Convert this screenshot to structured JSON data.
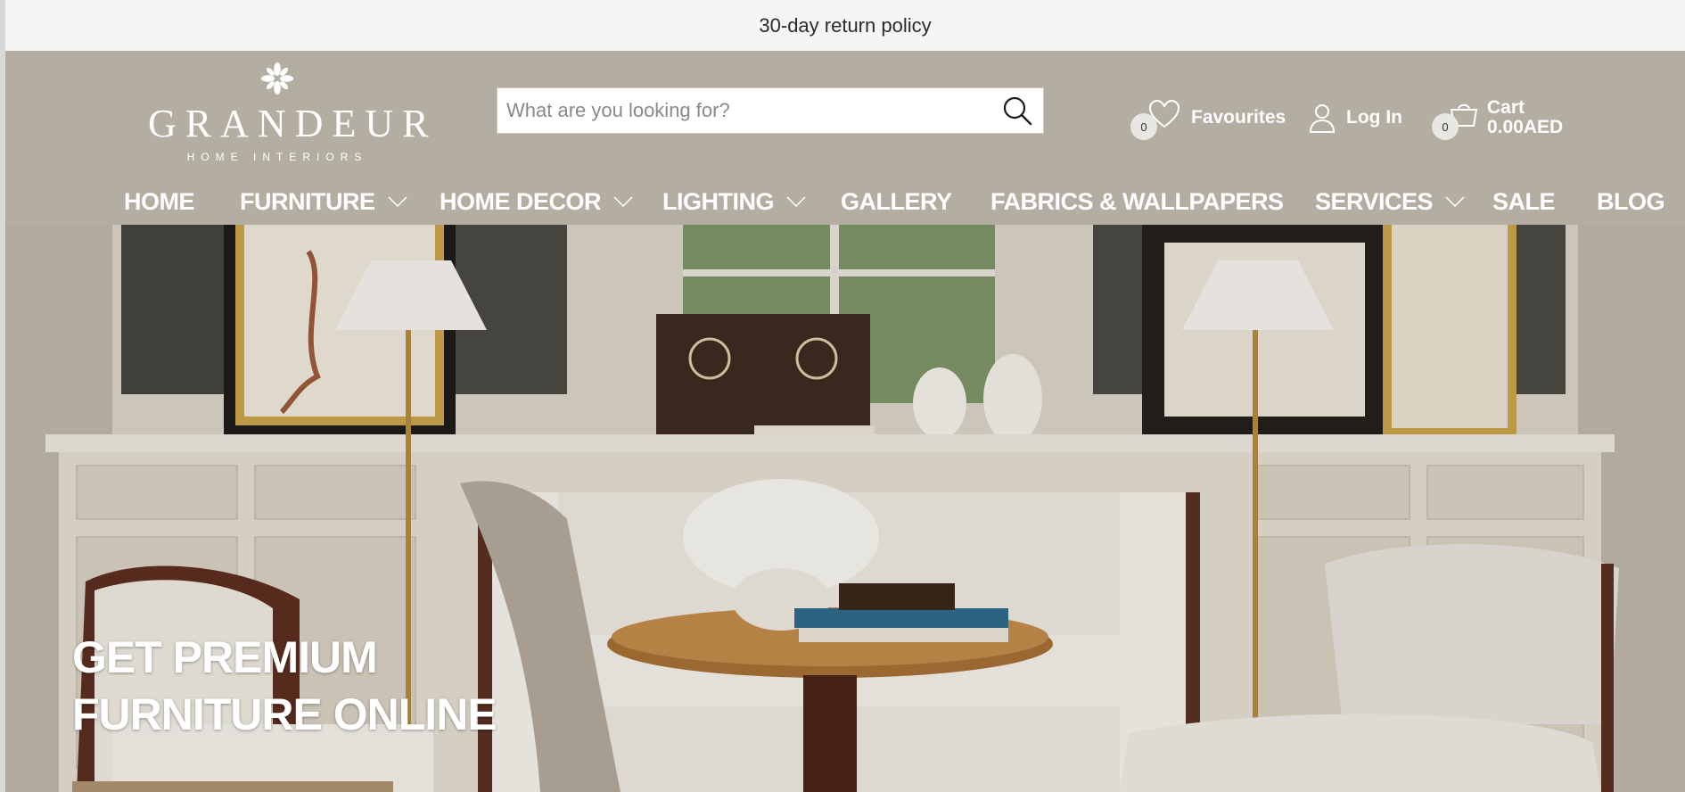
{
  "announcement": {
    "text": "30-day return policy"
  },
  "brand": {
    "name": "GRANDEUR",
    "tagline": "HOME INTERIORS"
  },
  "search": {
    "placeholder": "What are you looking for?",
    "icon": "search-icon"
  },
  "header_actions": {
    "favourites": {
      "label": "Favourites",
      "count": "0",
      "icon": "heart-icon"
    },
    "login": {
      "label": "Log In",
      "icon": "user-icon"
    },
    "cart": {
      "label": "Cart",
      "amount": "0.00AED",
      "count": "0",
      "icon": "cart-icon"
    }
  },
  "nav": {
    "items": [
      {
        "label": "HOME",
        "has_dropdown": false
      },
      {
        "label": "FURNITURE",
        "has_dropdown": true
      },
      {
        "label": "HOME DECOR",
        "has_dropdown": true
      },
      {
        "label": "LIGHTING",
        "has_dropdown": true
      },
      {
        "label": "GALLERY",
        "has_dropdown": false
      },
      {
        "label": "FABRICS & WALLPAPERS",
        "has_dropdown": false
      },
      {
        "label": "SERVICES",
        "has_dropdown": true
      },
      {
        "label": "SALE",
        "has_dropdown": false
      },
      {
        "label": "BLOG",
        "has_dropdown": false
      }
    ]
  },
  "hero": {
    "title_line1": "GET PREMIUM",
    "title_line2": "FURNITURE ONLINE"
  },
  "colors": {
    "header_bg": "#b4aea2",
    "announcement_bg": "#f5f5f5",
    "cta": "#a3896a",
    "text_light": "#ffffff"
  }
}
